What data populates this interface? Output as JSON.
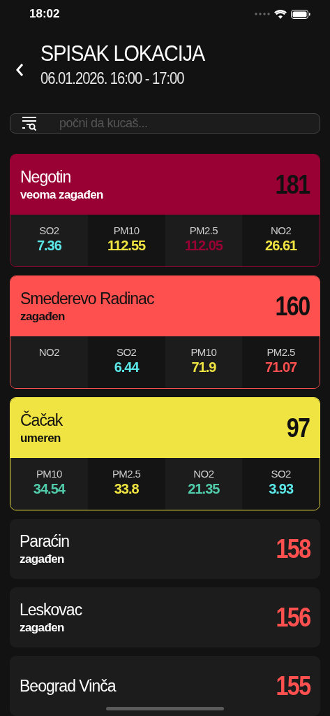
{
  "status_bar": {
    "time": "18:02"
  },
  "header": {
    "title": "SPISAK LOKACIJA",
    "subtitle": "06.01.2026. 16:00 - 17:00"
  },
  "search": {
    "placeholder": "počni da kucaš..."
  },
  "locations": [
    {
      "kind": "expanded",
      "name": "Negotin",
      "status": "veoma zagađen",
      "index": "181",
      "color": "#990033",
      "metrics": [
        {
          "label": "SO2",
          "value": "7.36",
          "color": "#5ce8e8"
        },
        {
          "label": "PM10",
          "value": "112.55",
          "color": "#f0e442"
        },
        {
          "label": "PM2.5",
          "value": "112.05",
          "color": "#990033"
        },
        {
          "label": "NO2",
          "value": "26.61",
          "color": "#f0e442"
        }
      ]
    },
    {
      "kind": "expanded",
      "name": "Smederevo Radinac",
      "status": "zagađen",
      "index": "160",
      "color": "#ff5050",
      "metrics": [
        {
          "label": "NO2"
        },
        {
          "label": "SO2",
          "value": "6.44",
          "color": "#5ce8e8"
        },
        {
          "label": "PM10",
          "value": "71.9",
          "color": "#f0e442"
        },
        {
          "label": "PM2.5",
          "value": "71.07",
          "color": "#ff5050"
        }
      ]
    },
    {
      "kind": "expanded",
      "name": "Čačak",
      "status": "umeren",
      "index": "97",
      "color": "#f0e442",
      "metrics": [
        {
          "label": "PM10",
          "value": "34.54",
          "color": "#50ccaa"
        },
        {
          "label": "PM2.5",
          "value": "33.8",
          "color": "#f0e442"
        },
        {
          "label": "NO2",
          "value": "21.35",
          "color": "#50ccaa"
        },
        {
          "label": "SO2",
          "value": "3.93",
          "color": "#5ce8e8"
        }
      ]
    },
    {
      "kind": "collapsed",
      "name": "Paraćin",
      "status": "zagađen",
      "index": "158",
      "color": "#ff5050"
    },
    {
      "kind": "collapsed",
      "name": "Leskovac",
      "status": "zagađen",
      "index": "156",
      "color": "#ff5050"
    },
    {
      "kind": "collapsed",
      "name": "Beograd Vinča",
      "index": "155",
      "color": "#ff5050"
    }
  ]
}
